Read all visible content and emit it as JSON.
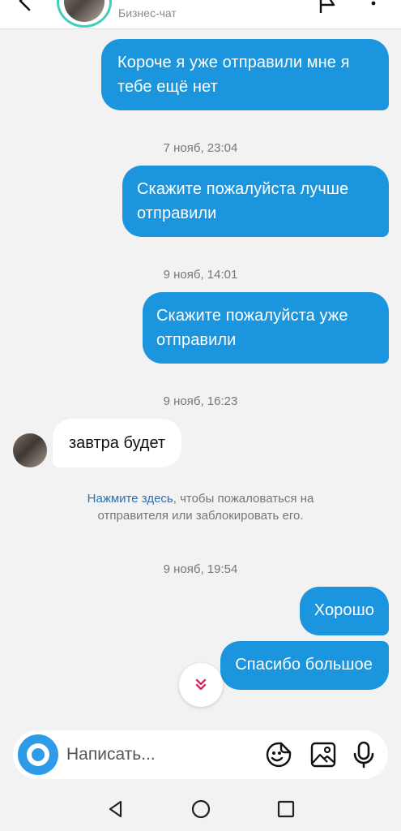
{
  "header": {
    "subtitle": "Бизнес-чат"
  },
  "messages": [
    {
      "type": "outgoing",
      "line1": "Короче я уже отправили мне я",
      "line2": "тебе ещё нет"
    },
    {
      "type": "timestamp",
      "text": "7 нояб, 23:04"
    },
    {
      "type": "outgoing",
      "line1": "Скажите пожалуйста лучше",
      "line2": "отправили"
    },
    {
      "type": "timestamp",
      "text": "9 нояб, 14:01"
    },
    {
      "type": "outgoing",
      "line1": "Скажите пожалуйста уже",
      "line2": "отправили"
    },
    {
      "type": "timestamp",
      "text": "9 нояб, 16:23"
    },
    {
      "type": "incoming",
      "text": "завтра будет"
    },
    {
      "type": "timestamp",
      "text": "9 нояб, 19:54"
    },
    {
      "type": "outgoing",
      "text": "Хорошо"
    },
    {
      "type": "outgoing",
      "text": "Спасибо большое"
    }
  ],
  "report": {
    "link": "Нажмите здесь",
    "text1": ", чтобы пожаловаться на",
    "text2": "отправителя или заблокировать его."
  },
  "composer": {
    "placeholder": "Написать..."
  },
  "colors": {
    "outgoing_bubble": "#1b95dd",
    "incoming_bubble": "#ffffff",
    "background": "#f2f2f2",
    "link": "#2f6fae",
    "scroll_arrow": "#d6285e"
  }
}
